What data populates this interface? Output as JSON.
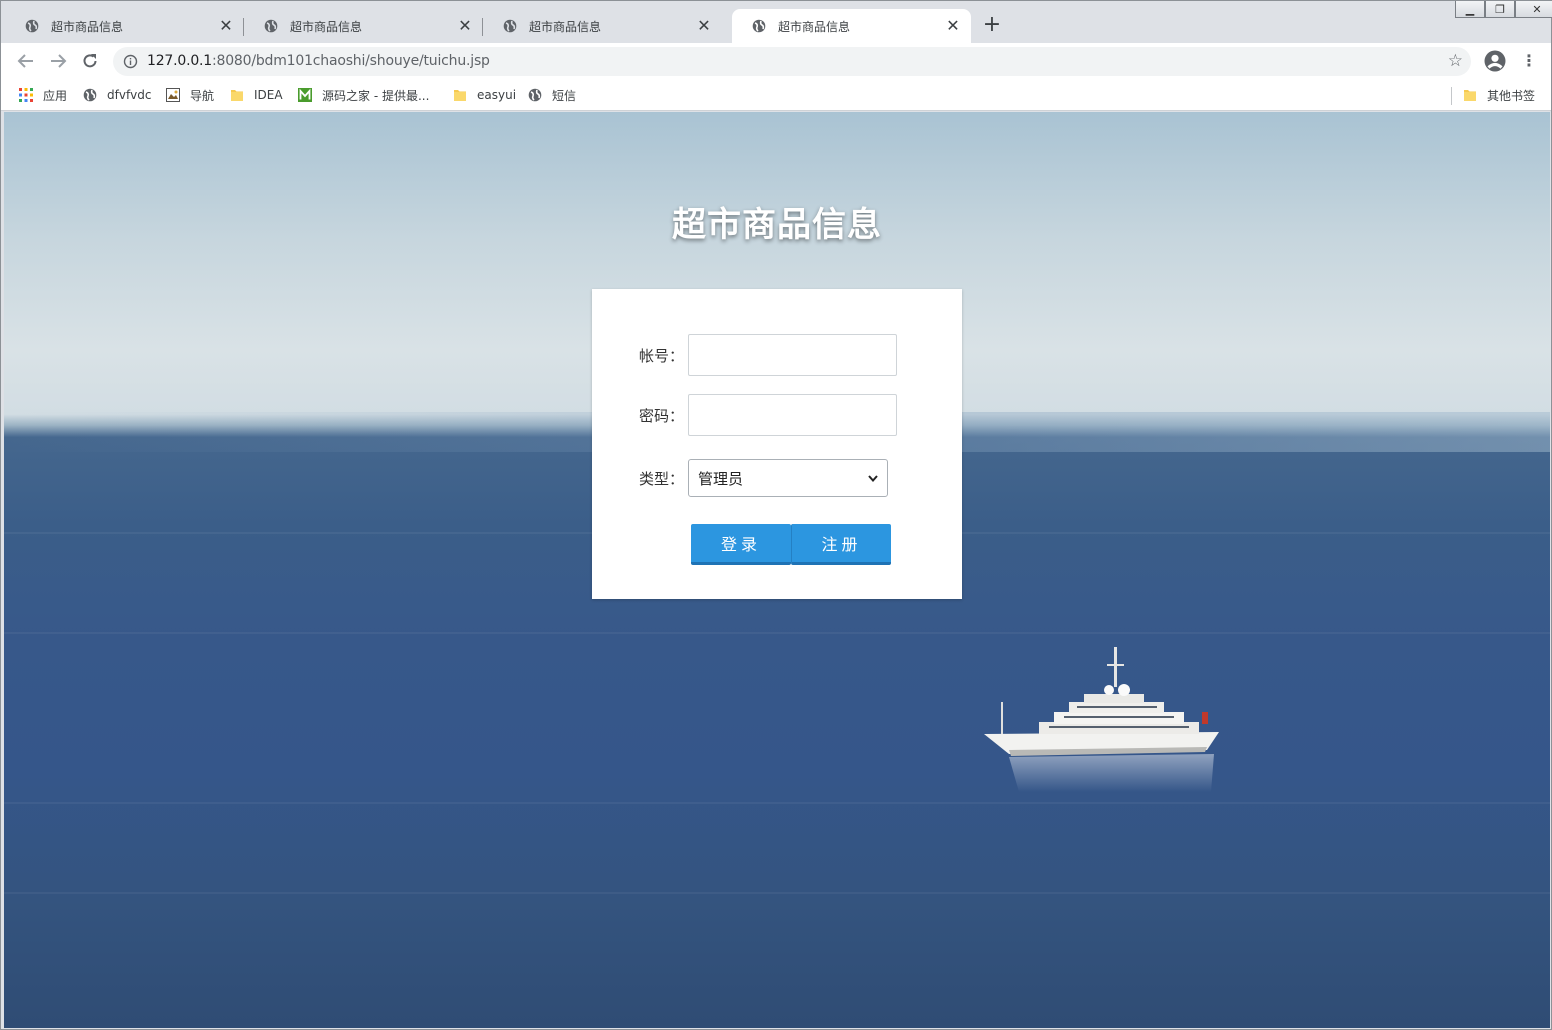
{
  "tabs": [
    {
      "title": "超市商品信息",
      "active": false
    },
    {
      "title": "超市商品信息",
      "active": false
    },
    {
      "title": "超市商品信息",
      "active": false
    },
    {
      "title": "超市商品信息",
      "active": true
    }
  ],
  "toolbar": {
    "url_host": "127.0.0.1",
    "url_rest": ":8080/bdm101chaoshi/shouye/tuichu.jsp"
  },
  "bookmarks": [
    {
      "label": "应用",
      "icon": "apps-grid-icon"
    },
    {
      "label": "dfvfvdc",
      "icon": "globe-icon"
    },
    {
      "label": "导航",
      "icon": "image-icon"
    },
    {
      "label": "IDEA",
      "icon": "folder-icon"
    },
    {
      "label": "源码之家 - 提供最...",
      "icon": "m-logo-icon"
    },
    {
      "label": "easyui",
      "icon": "folder-icon"
    },
    {
      "label": "短信",
      "icon": "globe-icon"
    }
  ],
  "other_bookmarks": "其他书签",
  "page": {
    "heading": "超市商品信息",
    "form": {
      "account_label": "帐号：",
      "account_value": "",
      "password_label": "密码：",
      "password_value": "",
      "type_label": "类型：",
      "type_selected": "管理员",
      "login_label": "登录",
      "register_label": "注册"
    }
  },
  "colors": {
    "button_blue": "#2c96e0",
    "tab_strip": "#dee1e6"
  }
}
